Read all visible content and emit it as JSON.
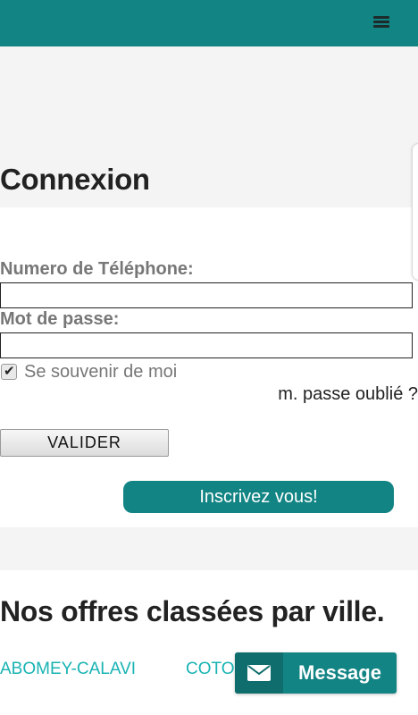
{
  "header": {
    "menu_icon": "hamburger-menu-icon",
    "color": "#138484"
  },
  "hero": {
    "title": "Connexion"
  },
  "login_form": {
    "phone_label": "Numero de Téléphone:",
    "phone_value": "",
    "password_label": "Mot de passe:",
    "password_value": "",
    "remember_label": "Se souvenir de moi",
    "remember_checked": true,
    "forgot_label": "m. passe oublié ?",
    "submit_label": "VALIDER",
    "signup_label": "Inscrivez vous!"
  },
  "offers": {
    "title": "Nos offres classées par ville.",
    "cities": [
      "ABOMEY-CALAVI",
      "COTO"
    ]
  },
  "message_button": {
    "label": "Message",
    "icon": "envelope-icon"
  },
  "colors": {
    "accent": "#138484",
    "link": "#19b3b3",
    "muted_text": "#777777"
  }
}
